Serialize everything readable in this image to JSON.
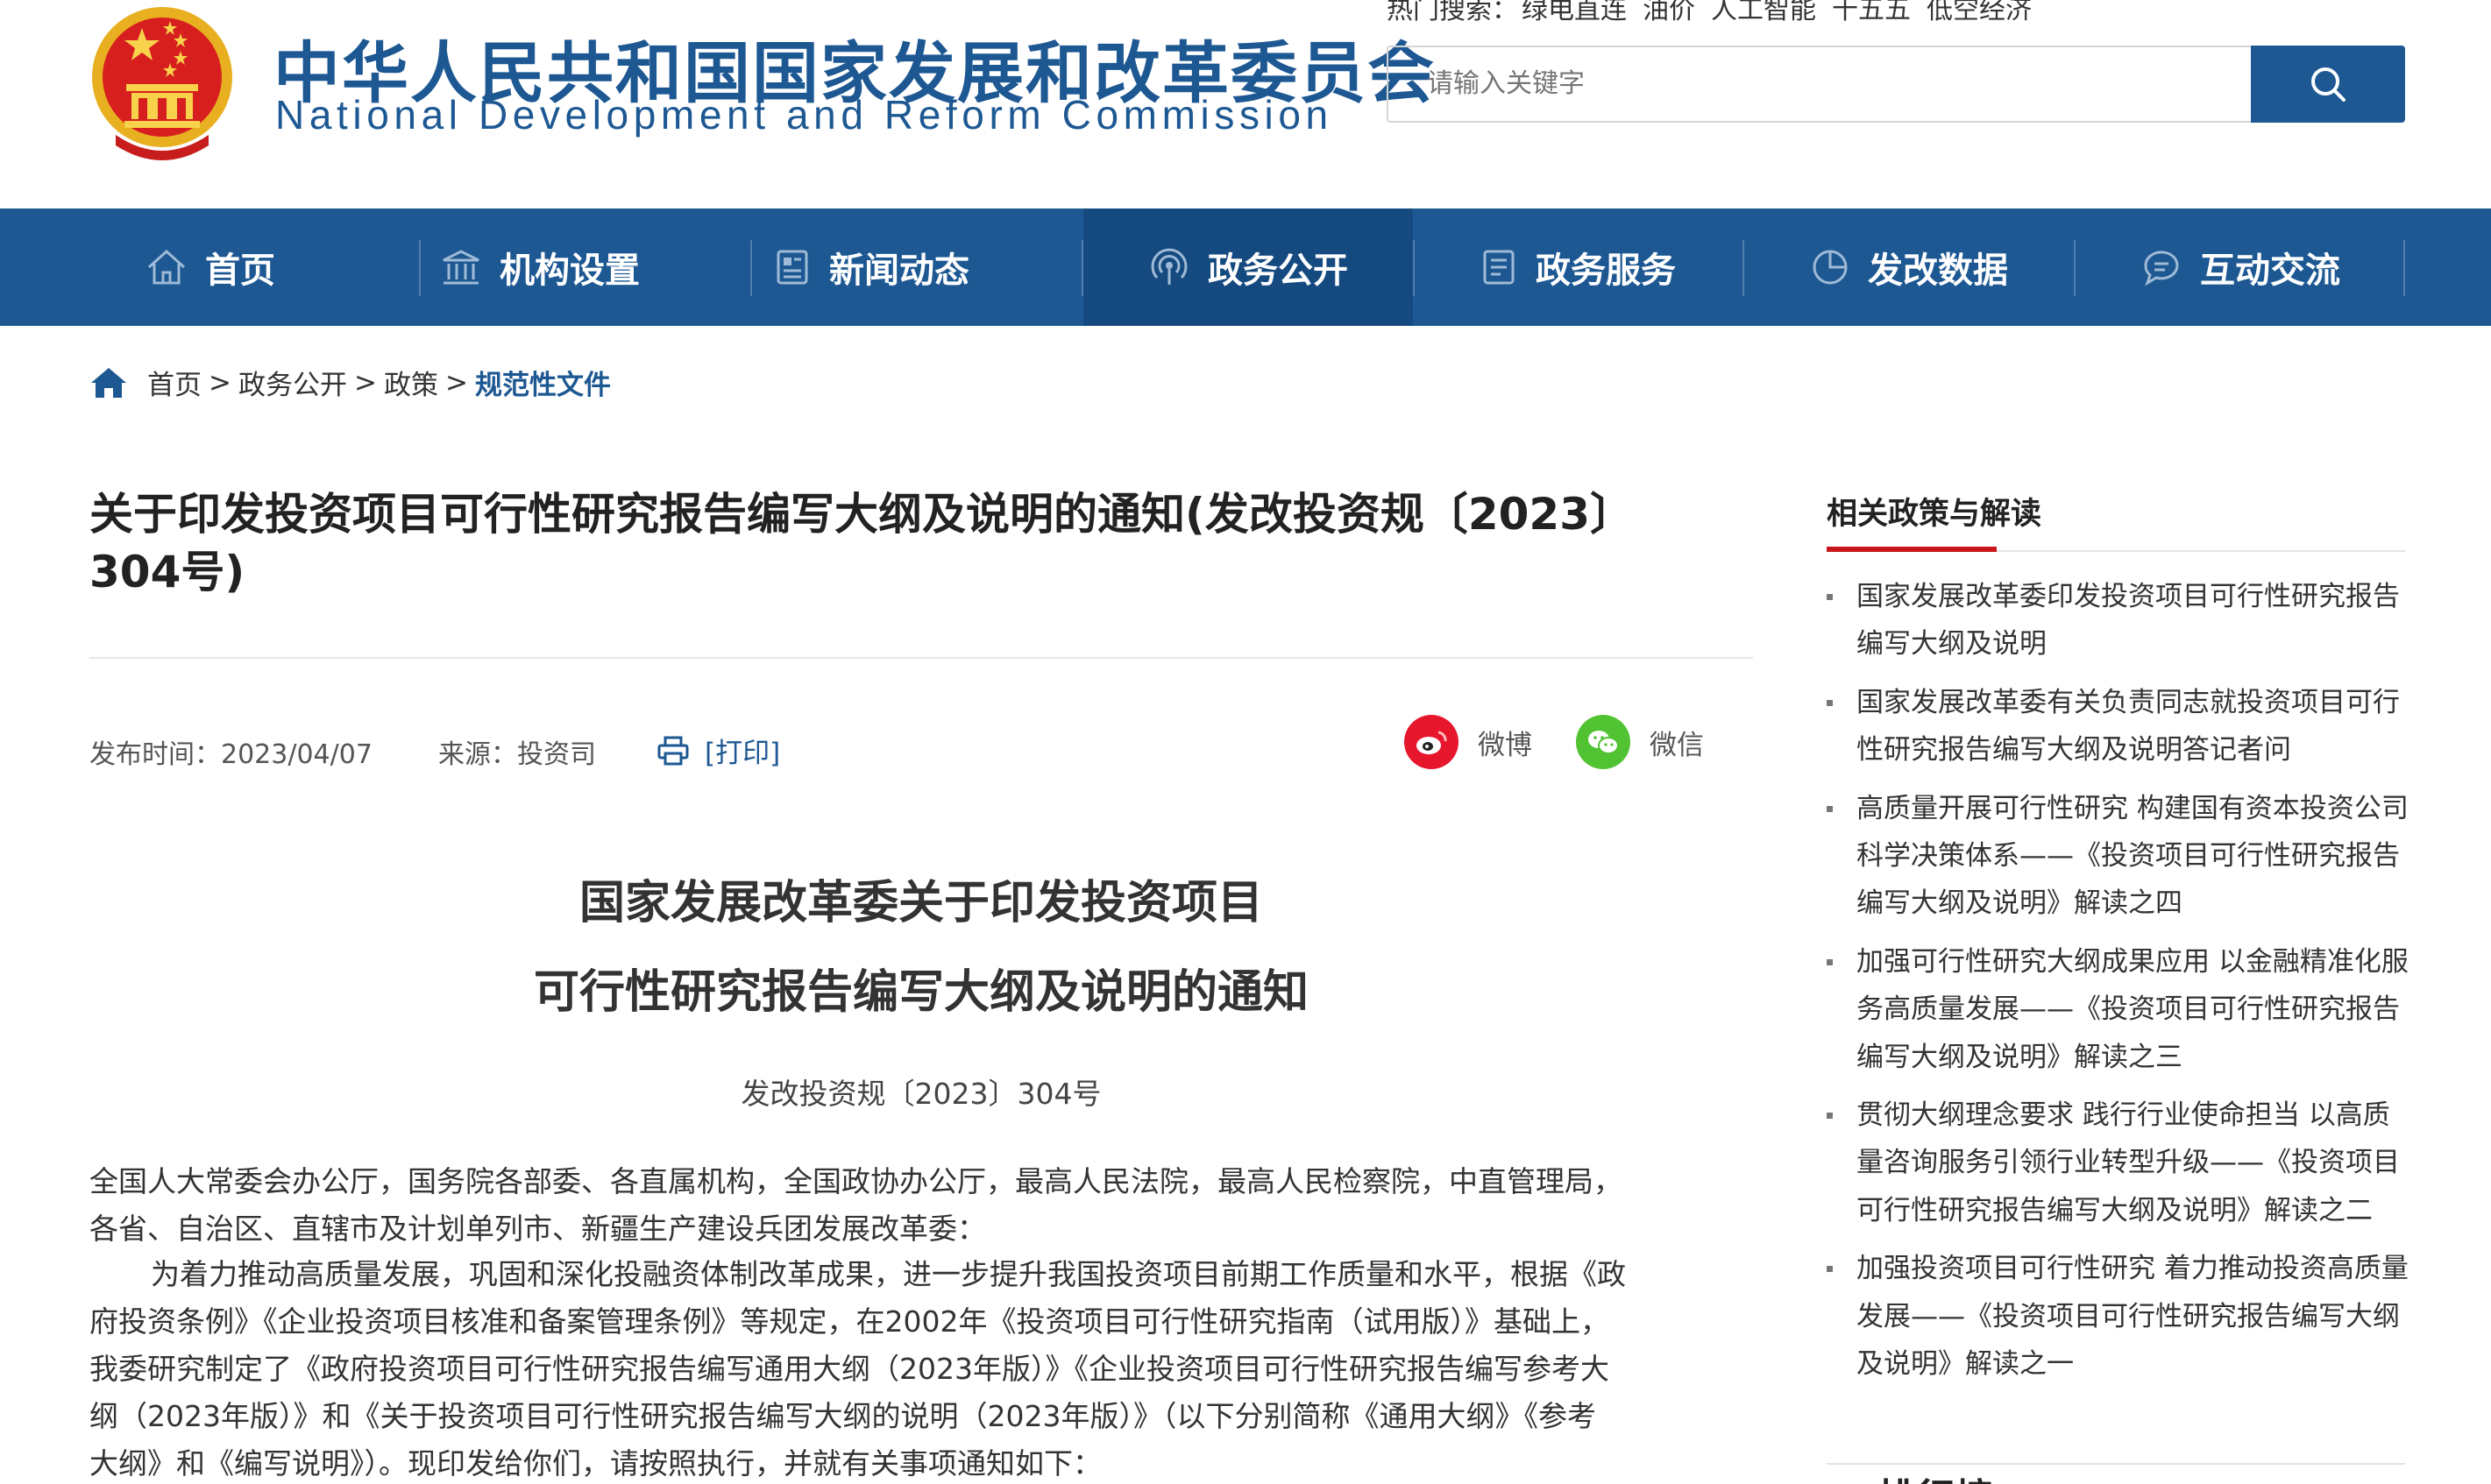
{
  "header": {
    "title_cn": "中华人民共和国国家发展和改革委员会",
    "title_en": "National Development and Reform Commission",
    "hot_label": "热门搜索：",
    "hot_terms": [
      "绿电直连",
      "油价",
      "人工智能",
      "十五五",
      "低空经济"
    ],
    "search_placeholder": "请输入关键字"
  },
  "nav": [
    {
      "label": "首页",
      "icon": "home-icon"
    },
    {
      "label": "机构设置",
      "icon": "institution-icon"
    },
    {
      "label": "新闻动态",
      "icon": "news-icon"
    },
    {
      "label": "政务公开",
      "icon": "broadcast-icon",
      "active": true
    },
    {
      "label": "政务服务",
      "icon": "service-icon"
    },
    {
      "label": "发改数据",
      "icon": "pie-chart-icon"
    },
    {
      "label": "互动交流",
      "icon": "chat-icon"
    }
  ],
  "breadcrumb": {
    "items": [
      "首页",
      "政务公开",
      "政策"
    ],
    "current": "规范性文件",
    "sep": ">"
  },
  "article": {
    "title_line1": "关于印发投资项目可行性研究报告编写大纲及说明的通知(发改投资规〔2023〕",
    "title_line2": "304号)",
    "publish": "发布时间：2023/04/07",
    "source": "来源：投资司",
    "print_label": "[打印]",
    "share_weibo": "微博",
    "share_wechat": "微信",
    "heading1": "国家发展改革委关于印发投资项目",
    "heading2": "可行性研究报告编写大纲及说明的通知",
    "doc_number": "发改投资规〔2023〕304号",
    "p1_line1": "全国人大常委会办公厅，国务院各部委、各直属机构，全国政协办公厅，最高人民法院，最高人民检察院，中直管理局，",
    "p1_line2": "各省、自治区、直辖市及计划单列市、新疆生产建设兵团发展改革委：",
    "p2_line1": "为着力推动高质量发展，巩固和深化投融资体制改革成果，进一步提升我国投资项目前期工作质量和水平，根据《政",
    "p2_line2": "府投资条例》《企业投资项目核准和备案管理条例》等规定，在2002年《投资项目可行性研究指南（试用版）》基础上，",
    "p2_line3": "我委研究制定了《政府投资项目可行性研究报告编写通用大纲（2023年版）》《企业投资项目可行性研究报告编写参考大",
    "p2_line4": "纲（2023年版）》和《关于投资项目可行性研究报告编写大纲的说明（2023年版）》（以下分别简称《通用大纲》《参考",
    "p2_line5": "大纲》和《编写说明》）。现印发给你们，请按照执行，并就有关事项通知如下："
  },
  "sidebar": {
    "heading": "相关政策与解读",
    "items": [
      {
        "l1": "国家发展改革委印发投资项目可行性研究报告",
        "l2": "编写大纲及说明"
      },
      {
        "l1": "国家发展改革委有关负责同志就投资项目可行",
        "l2": "性研究报告编写大纲及说明答记者问"
      },
      {
        "l1": "高质量开展可行性研究 构建国有资本投资公司",
        "l2": "科学决策体系——《投资项目可行性研究报告",
        "l3": "编写大纲及说明》解读之四"
      },
      {
        "l1": "加强可行性研究大纲成果应用 以金融精准化服",
        "l2": "务高质量发展——《投资项目可行性研究报告",
        "l3": "编写大纲及说明》解读之三"
      },
      {
        "l1": "贯彻大纲理念要求 践行行业使命担当 以高质",
        "l2": "量咨询服务引领行业转型升级——《投资项目",
        "l3": "可行性研究报告编写大纲及说明》解读之二"
      },
      {
        "l1": "加强投资项目可行性研究 着力推动投资高质量",
        "l2": "发展——《投资项目可行性研究报告编写大纲",
        "l3": "及说明》解读之一"
      }
    ],
    "rank_heading": "排行榜"
  },
  "colors": {
    "brand": "#1d5893",
    "accent_red": "#c8161d",
    "weibo": "#e6162d",
    "wechat": "#51c332"
  }
}
